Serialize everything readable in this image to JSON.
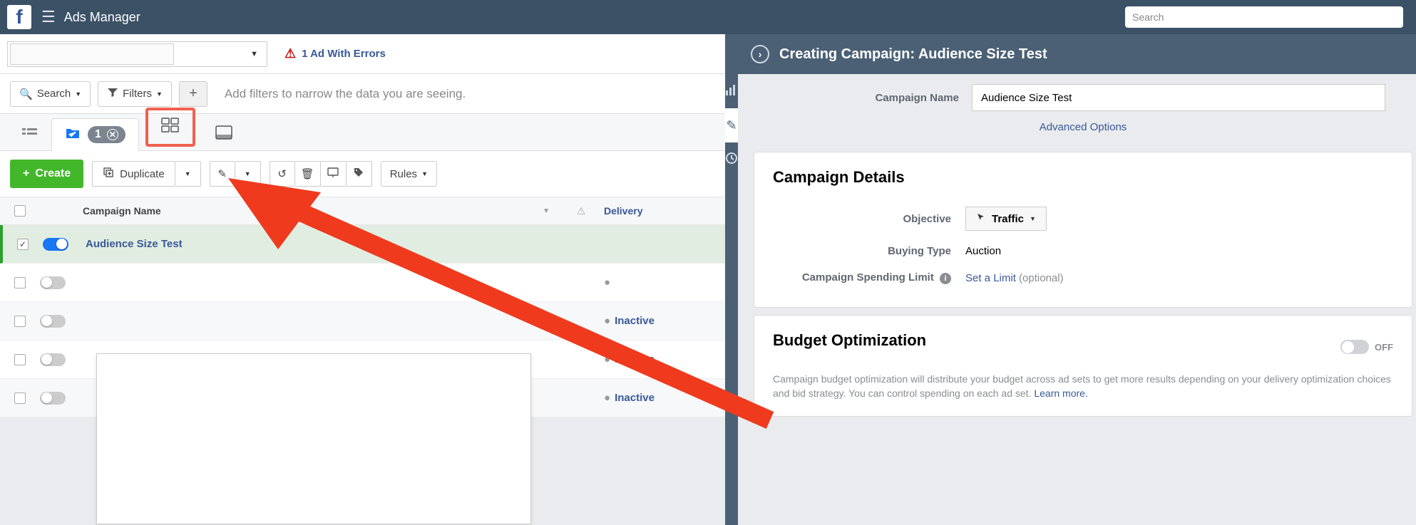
{
  "header": {
    "title": "Ads Manager",
    "search_placeholder": "Search"
  },
  "subhead": {
    "errors_text": "1 Ad With Errors"
  },
  "filterbar": {
    "search_label": "Search",
    "filters_label": "Filters",
    "placeholder": "Add filters to narrow the data you are seeing."
  },
  "tabbar": {
    "selected_count": "1"
  },
  "actionbar": {
    "create_label": "Create",
    "duplicate_label": "Duplicate",
    "rules_label": "Rules"
  },
  "table": {
    "col_name": "Campaign Name",
    "col_delivery": "Delivery",
    "rows": [
      {
        "name": "Audience Size Test",
        "delivery": "",
        "on": true,
        "checked": true
      },
      {
        "name": "",
        "delivery": "",
        "on": false,
        "checked": false
      },
      {
        "name": "",
        "delivery": "Inactive",
        "on": false,
        "checked": false
      },
      {
        "name": "",
        "delivery": "Inactive",
        "on": false,
        "checked": false
      },
      {
        "name": "",
        "delivery": "Inactive",
        "on": false,
        "checked": false
      }
    ]
  },
  "right": {
    "title": "Creating Campaign: Audience Size Test",
    "campaign_name_label": "Campaign Name",
    "campaign_name_value": "Audience Size Test",
    "advanced_options": "Advanced Options",
    "details_heading": "Campaign Details",
    "objective_label": "Objective",
    "objective_value": "Traffic",
    "buying_type_label": "Buying Type",
    "buying_type_value": "Auction",
    "spend_limit_label": "Campaign Spending Limit",
    "set_limit": "Set a Limit",
    "optional": "(optional)",
    "budget_heading": "Budget Optimization",
    "off_label": "OFF",
    "budget_desc_1": "Campaign budget optimization will distribute your budget across ad sets to get more results depending on your delivery optimization choices and bid strategy. You can control spending on each ad set. ",
    "learn_more": "Learn more."
  }
}
